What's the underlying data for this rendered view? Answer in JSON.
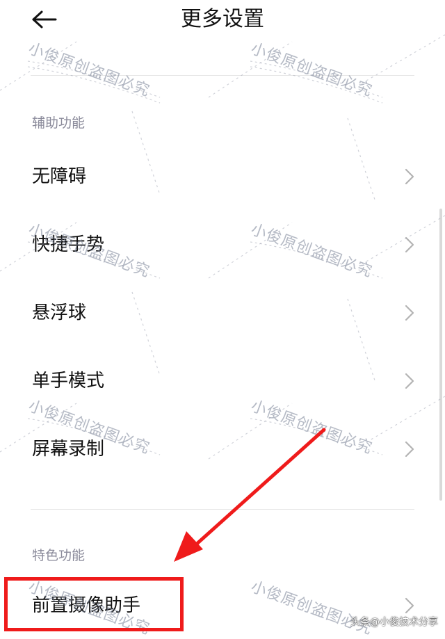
{
  "header": {
    "title": "更多设置",
    "back_icon": "arrow-left-icon"
  },
  "sections": [
    {
      "label": "辅助功能",
      "items": [
        {
          "label": "无障碍"
        },
        {
          "label": "快捷手势"
        },
        {
          "label": "悬浮球"
        },
        {
          "label": "单手模式"
        },
        {
          "label": "屏幕录制"
        }
      ]
    },
    {
      "label": "特色功能",
      "items": [
        {
          "label": "前置摄像助手"
        }
      ]
    }
  ],
  "watermark_text": "小俊原创盗图必究",
  "credit": "头条@小俊技术分享",
  "colors": {
    "highlight": "#ef1b1b",
    "section_label": "#8a8a9a",
    "divider": "#e6e6e6"
  }
}
